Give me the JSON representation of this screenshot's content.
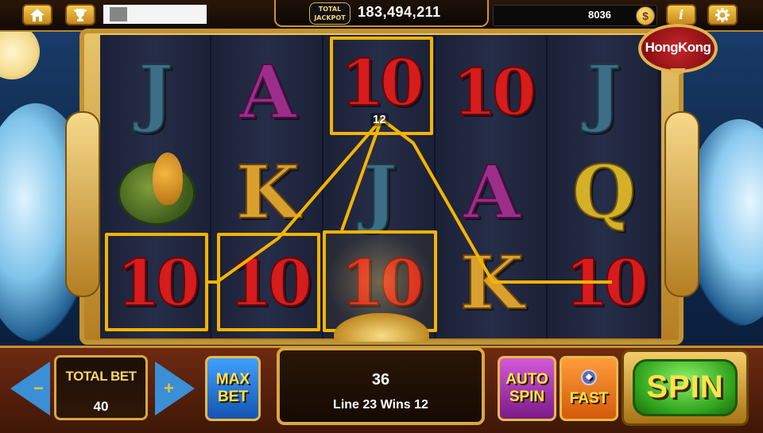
{
  "top_bar": {
    "home_icon": "home-icon",
    "trophy_icon": "trophy-icon",
    "jackpot_badge": "TOTAL JACKPOT",
    "jackpot_amount": "183,494,211",
    "credits": "8036",
    "coin_icon_glyph": "$",
    "info_glyph": "i",
    "settings_icon": "gear-icon"
  },
  "game": {
    "title_logo": "HongKong",
    "reels": [
      [
        "J",
        "turtle",
        "10"
      ],
      [
        "A",
        "K",
        "10"
      ],
      [
        "10",
        "J",
        "10"
      ],
      [
        "10",
        "A",
        "K"
      ],
      [
        "J",
        "Q",
        "10"
      ]
    ],
    "win_symbol_count": "12",
    "colors": {
      "win_line": "#f5b400",
      "spin_green": "#2ea01a",
      "frame_gold": "#c39331"
    }
  },
  "controls": {
    "total_bet_label": "TOTAL BET",
    "total_bet_value": "40",
    "bet_down_sign": "−",
    "bet_up_sign": "+",
    "max_bet_line1": "MAX",
    "max_bet_line2": "BET",
    "win_total": "36",
    "win_line_text": "Line 23 Wins 12",
    "auto_spin_line1": "AUTO",
    "auto_spin_line2": "SPIN",
    "fast_label": "FAST",
    "spin_label": "SPIN"
  }
}
